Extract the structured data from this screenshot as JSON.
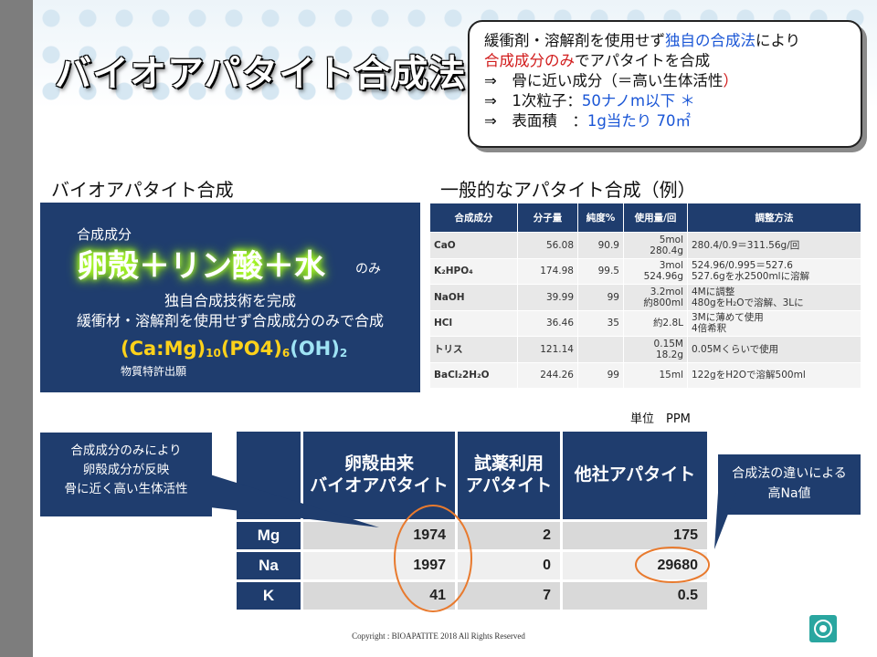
{
  "title": "バイオアパタイト合成法",
  "callout": {
    "line1_a": "緩衝剤・溶解剤を使用せず",
    "line1_b": "独自の合成法",
    "line1_c": "により",
    "line2_a": "合成成分のみ",
    "line2_b": "でアパタイトを合成",
    "line3_a": "⇒　骨に近い成分（＝高い生体活性",
    "line3_b": "）",
    "line4_a": "⇒　1次粒子：",
    "line4_b": "50ナノm以下 ＊",
    "line5_a": "⇒　表面積　：",
    "line5_b": "1g当たり 70㎡"
  },
  "left_heading": "バイオアパタイト合成",
  "right_heading": "一般的なアパタイト合成（例）",
  "bio": {
    "label": "合成成分",
    "big": "卵殻＋リン酸＋水",
    "nomi": "のみ",
    "line1": "独自合成技術を完成",
    "line2": "緩衝材・溶解剤を使用せず合成成分のみで合成",
    "f1": "(Ca:Mg)",
    "f1s": "10",
    "f2": "(PO4)",
    "f2s": "6",
    "f3": "(OH)",
    "f3s": "2",
    "patent": "物質特許出願"
  },
  "gen_table": {
    "headers": [
      "合成成分",
      "分子量",
      "純度%",
      "使用量/回",
      "調整方法"
    ],
    "rows": [
      [
        "CaO",
        "56.08",
        "90.9",
        "5mol\n280.4g",
        "280.4/0.9＝311.56g/回"
      ],
      [
        "K₂HPO₄",
        "174.98",
        "99.5",
        "3mol\n524.96g",
        "524.96/0.995＝527.6\n527.6gを水2500mlに溶解"
      ],
      [
        "NaOH",
        "39.99",
        "99",
        "3.2mol\n約800ml",
        "4Mに調整\n480gをH₂Oで溶解、3Lに"
      ],
      [
        "HCl",
        "36.46",
        "35",
        "約2.8L",
        "3Mに薄めて使用\n4倍希釈"
      ],
      [
        "トリス",
        "121.14",
        "",
        "0.15M\n18.2g",
        "0.05Mくらいで使用"
      ],
      [
        "BaCl₂2H₂O",
        "244.26",
        "99",
        "15ml",
        "122gをH2Oで溶解500ml"
      ]
    ]
  },
  "unit_label": "単位　PPM",
  "cmp_table": {
    "headers": [
      "",
      "卵殻由来\nバイオアパタイト",
      "試薬利用\nアパタイト",
      "他社アパタイト"
    ],
    "rows": [
      [
        "Mg",
        "1974",
        "2",
        "175"
      ],
      [
        "Na",
        "1997",
        "0",
        "29680"
      ],
      [
        "K",
        "41",
        "7",
        "0.5"
      ]
    ]
  },
  "note_left": "合成成分のみにより\n卵殻成分が反映\n骨に近く高い生体活性",
  "note_right": "合成法の違いによる\n高Na値",
  "copyright": "Copyright : BIOAPATITE 2018 All Rights Reserved",
  "colors": {
    "navy": "#1f3d6e",
    "blue_text": "#1a56d6",
    "red_text": "#d11b1b",
    "orange_circle": "#e87a2e"
  }
}
